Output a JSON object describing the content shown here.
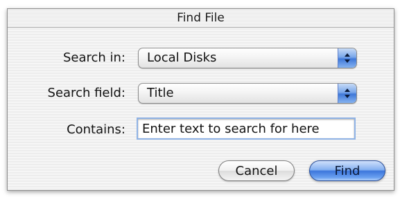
{
  "window": {
    "title": "Find File"
  },
  "form": {
    "search_in": {
      "label": "Search in:",
      "selected": "Local Disks"
    },
    "search_field": {
      "label": "Search field:",
      "selected": "Title"
    },
    "contains": {
      "label": "Contains:",
      "value": "Enter text to search for here"
    }
  },
  "buttons": {
    "cancel_label": "Cancel",
    "find_label": "Find"
  },
  "colors": {
    "accent": "#3c76dc",
    "focus_ring": "#8fb3e6"
  },
  "icons": {
    "popup_arrows": "up-down-arrows-icon"
  }
}
